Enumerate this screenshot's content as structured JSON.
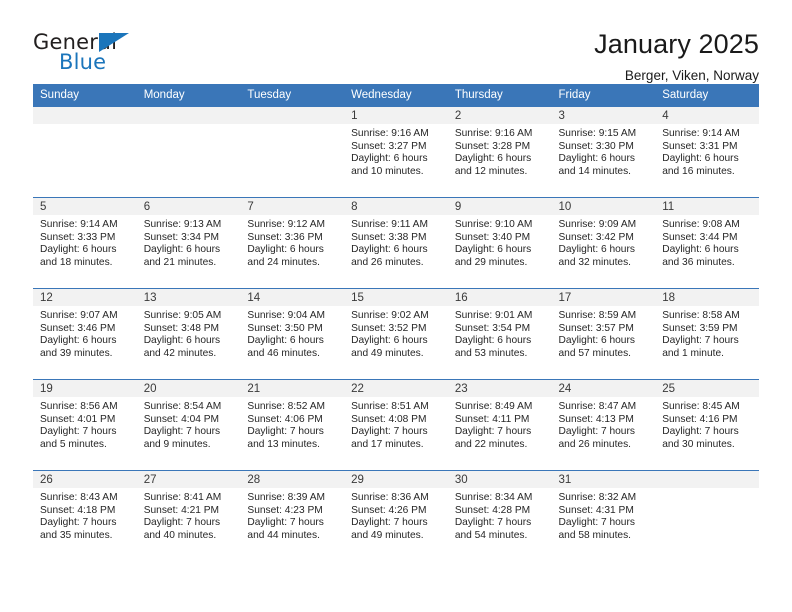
{
  "brand": {
    "word_one": "General",
    "word_two": "Blue",
    "accent_color": "#1b75bb"
  },
  "header": {
    "title": "January 2025",
    "subtitle": "Berger, Viken, Norway"
  },
  "calendar": {
    "header_background": "#3a76b8",
    "daynum_background": "#f2f2f2",
    "weekdays": [
      "Sunday",
      "Monday",
      "Tuesday",
      "Wednesday",
      "Thursday",
      "Friday",
      "Saturday"
    ],
    "leading_blanks": 3,
    "days": [
      {
        "num": "1",
        "sunrise": "Sunrise: 9:16 AM",
        "sunset": "Sunset: 3:27 PM",
        "daylight_1": "Daylight: 6 hours",
        "daylight_2": "and 10 minutes."
      },
      {
        "num": "2",
        "sunrise": "Sunrise: 9:16 AM",
        "sunset": "Sunset: 3:28 PM",
        "daylight_1": "Daylight: 6 hours",
        "daylight_2": "and 12 minutes."
      },
      {
        "num": "3",
        "sunrise": "Sunrise: 9:15 AM",
        "sunset": "Sunset: 3:30 PM",
        "daylight_1": "Daylight: 6 hours",
        "daylight_2": "and 14 minutes."
      },
      {
        "num": "4",
        "sunrise": "Sunrise: 9:14 AM",
        "sunset": "Sunset: 3:31 PM",
        "daylight_1": "Daylight: 6 hours",
        "daylight_2": "and 16 minutes."
      },
      {
        "num": "5",
        "sunrise": "Sunrise: 9:14 AM",
        "sunset": "Sunset: 3:33 PM",
        "daylight_1": "Daylight: 6 hours",
        "daylight_2": "and 18 minutes."
      },
      {
        "num": "6",
        "sunrise": "Sunrise: 9:13 AM",
        "sunset": "Sunset: 3:34 PM",
        "daylight_1": "Daylight: 6 hours",
        "daylight_2": "and 21 minutes."
      },
      {
        "num": "7",
        "sunrise": "Sunrise: 9:12 AM",
        "sunset": "Sunset: 3:36 PM",
        "daylight_1": "Daylight: 6 hours",
        "daylight_2": "and 24 minutes."
      },
      {
        "num": "8",
        "sunrise": "Sunrise: 9:11 AM",
        "sunset": "Sunset: 3:38 PM",
        "daylight_1": "Daylight: 6 hours",
        "daylight_2": "and 26 minutes."
      },
      {
        "num": "9",
        "sunrise": "Sunrise: 9:10 AM",
        "sunset": "Sunset: 3:40 PM",
        "daylight_1": "Daylight: 6 hours",
        "daylight_2": "and 29 minutes."
      },
      {
        "num": "10",
        "sunrise": "Sunrise: 9:09 AM",
        "sunset": "Sunset: 3:42 PM",
        "daylight_1": "Daylight: 6 hours",
        "daylight_2": "and 32 minutes."
      },
      {
        "num": "11",
        "sunrise": "Sunrise: 9:08 AM",
        "sunset": "Sunset: 3:44 PM",
        "daylight_1": "Daylight: 6 hours",
        "daylight_2": "and 36 minutes."
      },
      {
        "num": "12",
        "sunrise": "Sunrise: 9:07 AM",
        "sunset": "Sunset: 3:46 PM",
        "daylight_1": "Daylight: 6 hours",
        "daylight_2": "and 39 minutes."
      },
      {
        "num": "13",
        "sunrise": "Sunrise: 9:05 AM",
        "sunset": "Sunset: 3:48 PM",
        "daylight_1": "Daylight: 6 hours",
        "daylight_2": "and 42 minutes."
      },
      {
        "num": "14",
        "sunrise": "Sunrise: 9:04 AM",
        "sunset": "Sunset: 3:50 PM",
        "daylight_1": "Daylight: 6 hours",
        "daylight_2": "and 46 minutes."
      },
      {
        "num": "15",
        "sunrise": "Sunrise: 9:02 AM",
        "sunset": "Sunset: 3:52 PM",
        "daylight_1": "Daylight: 6 hours",
        "daylight_2": "and 49 minutes."
      },
      {
        "num": "16",
        "sunrise": "Sunrise: 9:01 AM",
        "sunset": "Sunset: 3:54 PM",
        "daylight_1": "Daylight: 6 hours",
        "daylight_2": "and 53 minutes."
      },
      {
        "num": "17",
        "sunrise": "Sunrise: 8:59 AM",
        "sunset": "Sunset: 3:57 PM",
        "daylight_1": "Daylight: 6 hours",
        "daylight_2": "and 57 minutes."
      },
      {
        "num": "18",
        "sunrise": "Sunrise: 8:58 AM",
        "sunset": "Sunset: 3:59 PM",
        "daylight_1": "Daylight: 7 hours",
        "daylight_2": "and 1 minute."
      },
      {
        "num": "19",
        "sunrise": "Sunrise: 8:56 AM",
        "sunset": "Sunset: 4:01 PM",
        "daylight_1": "Daylight: 7 hours",
        "daylight_2": "and 5 minutes."
      },
      {
        "num": "20",
        "sunrise": "Sunrise: 8:54 AM",
        "sunset": "Sunset: 4:04 PM",
        "daylight_1": "Daylight: 7 hours",
        "daylight_2": "and 9 minutes."
      },
      {
        "num": "21",
        "sunrise": "Sunrise: 8:52 AM",
        "sunset": "Sunset: 4:06 PM",
        "daylight_1": "Daylight: 7 hours",
        "daylight_2": "and 13 minutes."
      },
      {
        "num": "22",
        "sunrise": "Sunrise: 8:51 AM",
        "sunset": "Sunset: 4:08 PM",
        "daylight_1": "Daylight: 7 hours",
        "daylight_2": "and 17 minutes."
      },
      {
        "num": "23",
        "sunrise": "Sunrise: 8:49 AM",
        "sunset": "Sunset: 4:11 PM",
        "daylight_1": "Daylight: 7 hours",
        "daylight_2": "and 22 minutes."
      },
      {
        "num": "24",
        "sunrise": "Sunrise: 8:47 AM",
        "sunset": "Sunset: 4:13 PM",
        "daylight_1": "Daylight: 7 hours",
        "daylight_2": "and 26 minutes."
      },
      {
        "num": "25",
        "sunrise": "Sunrise: 8:45 AM",
        "sunset": "Sunset: 4:16 PM",
        "daylight_1": "Daylight: 7 hours",
        "daylight_2": "and 30 minutes."
      },
      {
        "num": "26",
        "sunrise": "Sunrise: 8:43 AM",
        "sunset": "Sunset: 4:18 PM",
        "daylight_1": "Daylight: 7 hours",
        "daylight_2": "and 35 minutes."
      },
      {
        "num": "27",
        "sunrise": "Sunrise: 8:41 AM",
        "sunset": "Sunset: 4:21 PM",
        "daylight_1": "Daylight: 7 hours",
        "daylight_2": "and 40 minutes."
      },
      {
        "num": "28",
        "sunrise": "Sunrise: 8:39 AM",
        "sunset": "Sunset: 4:23 PM",
        "daylight_1": "Daylight: 7 hours",
        "daylight_2": "and 44 minutes."
      },
      {
        "num": "29",
        "sunrise": "Sunrise: 8:36 AM",
        "sunset": "Sunset: 4:26 PM",
        "daylight_1": "Daylight: 7 hours",
        "daylight_2": "and 49 minutes."
      },
      {
        "num": "30",
        "sunrise": "Sunrise: 8:34 AM",
        "sunset": "Sunset: 4:28 PM",
        "daylight_1": "Daylight: 7 hours",
        "daylight_2": "and 54 minutes."
      },
      {
        "num": "31",
        "sunrise": "Sunrise: 8:32 AM",
        "sunset": "Sunset: 4:31 PM",
        "daylight_1": "Daylight: 7 hours",
        "daylight_2": "and 58 minutes."
      }
    ]
  }
}
